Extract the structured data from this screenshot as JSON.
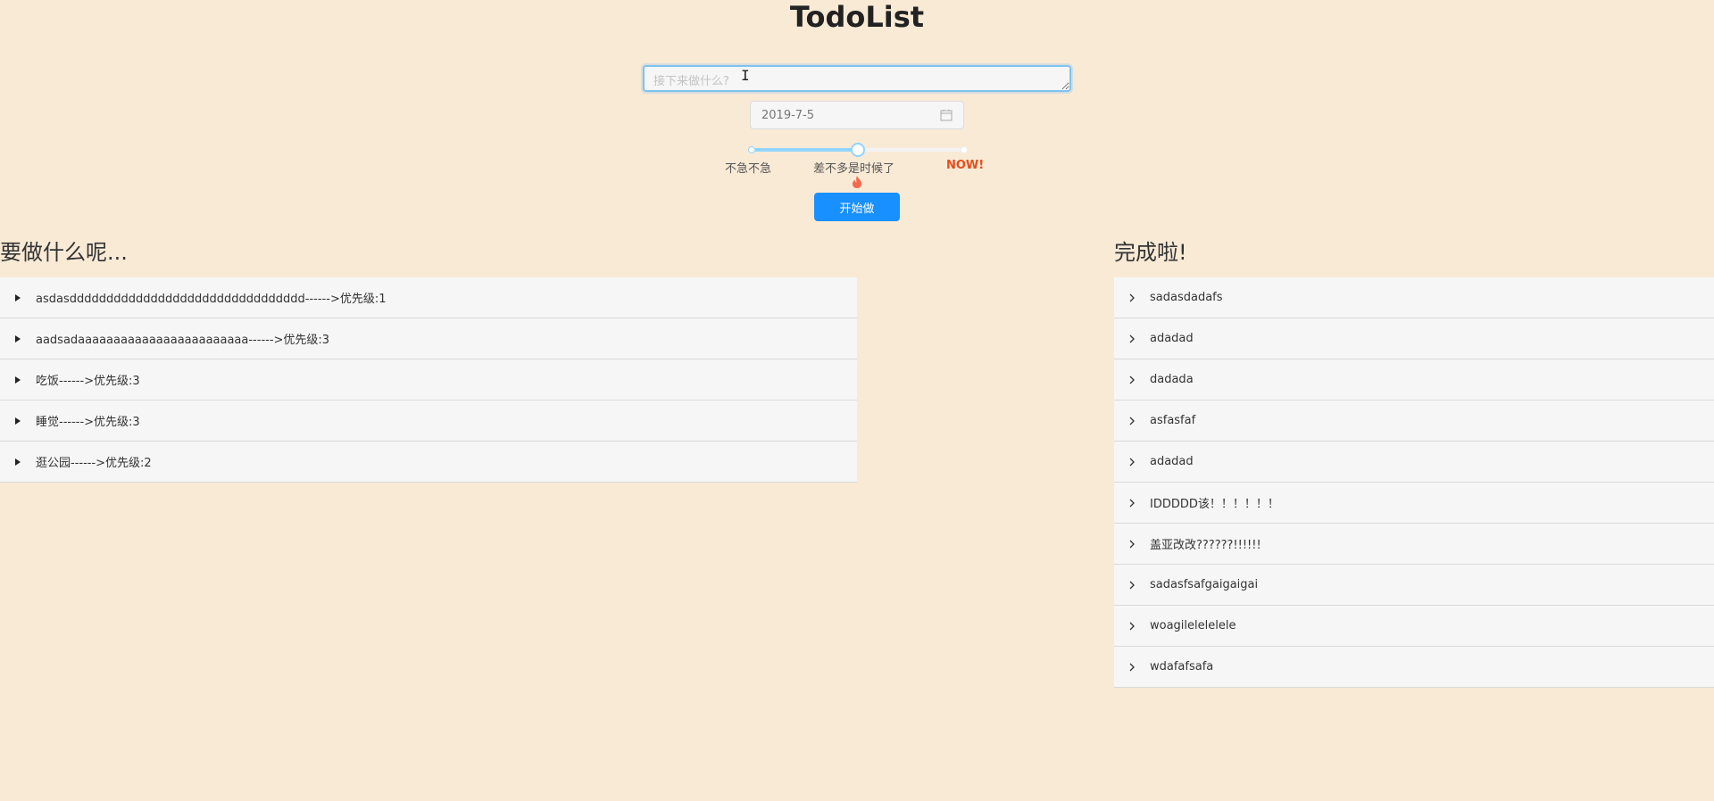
{
  "app": {
    "title": "TodoList"
  },
  "form": {
    "task_placeholder": "接下来做什么?",
    "date_value": "2019-7-5",
    "priority": {
      "value_fraction": 0.5,
      "marks": {
        "low": "不急不急",
        "mid": "差不多是时候了",
        "high": "NOW!"
      }
    },
    "submit_label": "开始做"
  },
  "todo": {
    "heading": "要做什么呢...",
    "items": [
      "asdasdddddddddddddddddddddddddddddddd------>优先级:1",
      "aadsadaaaaaaaaaaaaaaaaaaaaaaaa------>优先级:3",
      "吃饭------>优先级:3",
      "睡觉------>优先级:3",
      "逛公园------>优先级:2"
    ]
  },
  "done": {
    "heading": "完成啦!",
    "items": [
      "sadasdadafs",
      "adadad",
      "dadada",
      "asfasfaf",
      "adadad",
      "IDDDDD该！！！！！！",
      "盖亚改改??????!!!!!!",
      "sadasfsafgaigaigai",
      "woagilelelelele",
      "wdafafsafa"
    ]
  },
  "colors": {
    "background": "#f9ead6",
    "accent": "#1890ff",
    "now": "#e84d1a",
    "slider": "#91d5ff"
  },
  "icons": {
    "todo_arrow": "caret-right-icon",
    "done_arrow": "chevron-right-icon",
    "date": "calendar-icon",
    "priority": "fire-icon"
  }
}
